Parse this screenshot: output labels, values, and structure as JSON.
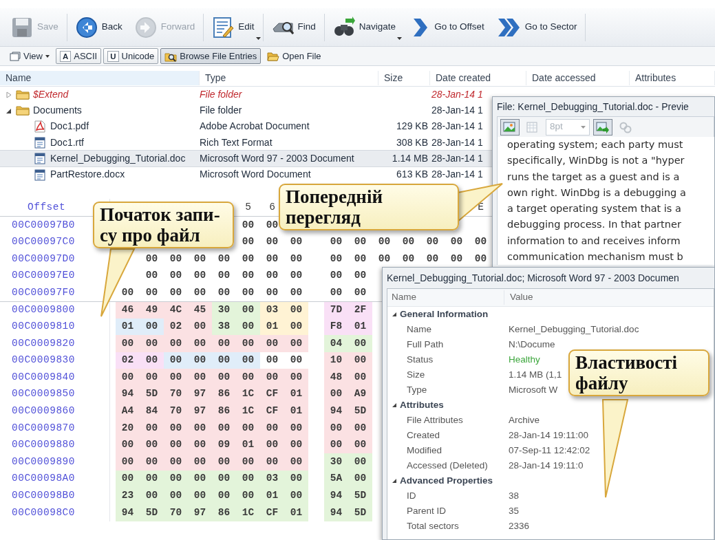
{
  "toolbar": [
    {
      "label": "Save",
      "disabled": true,
      "dropdown": false
    },
    {
      "label": "Back",
      "disabled": false,
      "dropdown": false
    },
    {
      "label": "Forward",
      "disabled": true,
      "dropdown": false
    },
    {
      "label": "Edit",
      "disabled": false,
      "dropdown": true
    },
    {
      "label": "Find",
      "disabled": false,
      "dropdown": false
    },
    {
      "label": "Navigate",
      "disabled": false,
      "dropdown": true
    },
    {
      "label": "Go to Offset",
      "disabled": false,
      "dropdown": false
    },
    {
      "label": "Go to Sector",
      "disabled": false,
      "dropdown": false
    }
  ],
  "view_bar": {
    "view": {
      "label": "View"
    },
    "toggles": [
      {
        "glyph": "A",
        "label": "ASCII",
        "pressed": false
      },
      {
        "glyph": "U",
        "label": "Unicode",
        "pressed": false
      },
      {
        "label": "Browse File Entries",
        "pressed": true
      }
    ],
    "open_file": {
      "label": "Open File"
    }
  },
  "file_list": {
    "columns": [
      "Name",
      "Type",
      "Size",
      "Date created",
      "Date accessed",
      "Attributes"
    ],
    "rows": [
      {
        "kind": "folder",
        "name": "$Extend",
        "type": "File folder",
        "date_created": "28-Jan-14 1",
        "deleted": true,
        "expanded": false,
        "selected": false,
        "children": []
      },
      {
        "kind": "folder",
        "name": "Documents",
        "type": "File folder",
        "date_created": "28-Jan-14 1",
        "deleted": false,
        "expanded": true,
        "selected": false,
        "children": [
          {
            "kind": "pdf",
            "name": "Doc1.pdf",
            "type": "Adobe Acrobat Document",
            "size": "129 KB",
            "date_created": "28-Jan-14 1",
            "deleted": false,
            "selected": false
          },
          {
            "kind": "doc",
            "name": "Doc1.rtf",
            "type": "Rich Text Format",
            "size": "308 KB",
            "date_created": "28-Jan-14 1",
            "deleted": false,
            "selected": false
          },
          {
            "kind": "doc",
            "name": "Kernel_Debugging_Tutorial.doc",
            "type": "Microsoft Word 97 - 2003 Document",
            "size": "1.14 MB",
            "date_created": "28-Jan-14 1",
            "deleted": false,
            "selected": true
          },
          {
            "kind": "doc",
            "name": "PartRestore.docx",
            "type": "Microsoft Word Document",
            "size": "613 KB",
            "date_created": "28-Jan-14 1",
            "deleted": false,
            "selected": false
          }
        ]
      }
    ]
  },
  "hex_view": {
    "offset_label": "Offset",
    "columns": [
      null,
      null,
      null,
      null,
      null,
      "5",
      "6",
      null,
      null,
      null,
      null,
      null,
      null,
      null,
      "E"
    ],
    "rows": [
      {
        "offset": "00C00097B0",
        "sector_start": false,
        "cells": [
          null,
          null,
          null,
          null,
          null,
          {
            "text": "00"
          },
          {
            "text": "00"
          }
        ]
      },
      {
        "offset": "00C00097C0",
        "sector_start": false,
        "cells": [
          null,
          null,
          null,
          null,
          null,
          {
            "text": "00"
          },
          {
            "text": "00"
          },
          {
            "text": "00"
          },
          {
            "text": "00"
          },
          {
            "text": "00"
          },
          {
            "text": "00"
          },
          {
            "text": "00"
          },
          {
            "text": "00"
          },
          {
            "text": "00"
          },
          {
            "text": "00"
          }
        ]
      },
      {
        "offset": "00C00097D0",
        "sector_start": false,
        "cells": [
          null,
          {
            "text": "00"
          },
          {
            "text": "00"
          },
          {
            "text": "00"
          },
          {
            "text": "00"
          },
          {
            "text": "00"
          },
          {
            "text": "00"
          },
          {
            "text": "00"
          },
          {
            "text": "00"
          },
          {
            "text": "00"
          },
          {
            "text": "00"
          },
          {
            "text": "00"
          },
          {
            "text": "00"
          },
          {
            "text": "00"
          },
          {
            "text": "00"
          }
        ]
      },
      {
        "offset": "00C00097E0",
        "sector_start": false,
        "cells": [
          null,
          {
            "text": "00"
          },
          {
            "text": "00"
          },
          {
            "text": "00"
          },
          {
            "text": "00"
          },
          {
            "text": "00"
          },
          {
            "text": "00"
          },
          {
            "text": "00"
          },
          {
            "text": "00"
          },
          {
            "text": "00"
          }
        ]
      },
      {
        "offset": "00C00097F0",
        "sector_start": false,
        "cells": [
          {
            "text": "00"
          },
          {
            "text": "00"
          },
          {
            "text": "00"
          },
          {
            "text": "00"
          },
          {
            "text": "00"
          },
          {
            "text": "00"
          },
          {
            "text": "00"
          },
          {
            "text": "00"
          },
          {
            "text": "00"
          },
          {
            "text": "00"
          }
        ]
      },
      {
        "offset": "00C0009800",
        "sector_start": true,
        "cells": [
          {
            "text": "46",
            "color": "#fbe1e3"
          },
          {
            "text": "49",
            "color": "#fbe1e3"
          },
          {
            "text": "4C",
            "color": "#fbe1e3"
          },
          {
            "text": "45",
            "color": "#fbe1e3"
          },
          {
            "text": "30",
            "color": "#e3f4da"
          },
          {
            "text": "00",
            "color": "#e3f4da"
          },
          {
            "text": "03",
            "color": "#fff3d4"
          },
          {
            "text": "00",
            "color": "#fff3d4"
          },
          {
            "text": "7D",
            "color": "#f9e0f6"
          },
          {
            "text": "2F",
            "color": "#f9e0f6"
          }
        ]
      },
      {
        "offset": "00C0009810",
        "sector_start": false,
        "cells": [
          {
            "text": "01",
            "color": "#e0edf9"
          },
          {
            "text": "00",
            "color": "#e0edf9"
          },
          {
            "text": "02",
            "color": "#fbe1e3"
          },
          {
            "text": "00",
            "color": "#fbe1e3"
          },
          {
            "text": "38",
            "color": "#e3f4da"
          },
          {
            "text": "00",
            "color": "#e3f4da"
          },
          {
            "text": "01",
            "color": "#fff3d4"
          },
          {
            "text": "00",
            "color": "#fff3d4"
          },
          {
            "text": "F8",
            "color": "#f9e0f6"
          },
          {
            "text": "01",
            "color": "#f9e0f6"
          }
        ]
      },
      {
        "offset": "00C0009820",
        "sector_start": false,
        "cells": [
          {
            "text": "00",
            "color": "#fbe1e3"
          },
          {
            "text": "00",
            "color": "#fbe1e3"
          },
          {
            "text": "00",
            "color": "#fbe1e3"
          },
          {
            "text": "00",
            "color": "#fbe1e3"
          },
          {
            "text": "00",
            "color": "#fbe1e3"
          },
          {
            "text": "00",
            "color": "#fbe1e3"
          },
          {
            "text": "00",
            "color": "#fbe1e3"
          },
          {
            "text": "00",
            "color": "#fbe1e3"
          },
          {
            "text": "04",
            "color": "#e3f4da"
          },
          {
            "text": "00",
            "color": "#e3f4da"
          }
        ]
      },
      {
        "offset": "00C0009830",
        "sector_start": false,
        "cells": [
          {
            "text": "02",
            "color": "#f9e0f6"
          },
          {
            "text": "00",
            "color": "#f9e0f6"
          },
          {
            "text": "00",
            "color": "#e0edf9"
          },
          {
            "text": "00",
            "color": "#e0edf9"
          },
          {
            "text": "00",
            "color": "#e0edf9"
          },
          {
            "text": "00",
            "color": "#e0edf9"
          },
          {
            "text": "00"
          },
          {
            "text": "00"
          },
          {
            "text": "10",
            "color": "#fbe1e3"
          },
          {
            "text": "00",
            "color": "#fbe1e3"
          }
        ]
      },
      {
        "offset": "00C0009840",
        "sector_start": false,
        "cells": [
          {
            "text": "00",
            "color": "#fbe1e3"
          },
          {
            "text": "00",
            "color": "#fbe1e3"
          },
          {
            "text": "00",
            "color": "#fbe1e3"
          },
          {
            "text": "00",
            "color": "#fbe1e3"
          },
          {
            "text": "00",
            "color": "#fbe1e3"
          },
          {
            "text": "00",
            "color": "#fbe1e3"
          },
          {
            "text": "00",
            "color": "#fbe1e3"
          },
          {
            "text": "00",
            "color": "#fbe1e3"
          },
          {
            "text": "48",
            "color": "#fbe1e3"
          },
          {
            "text": "00",
            "color": "#fbe1e3"
          }
        ]
      },
      {
        "offset": "00C0009850",
        "sector_start": false,
        "cells": [
          {
            "text": "94",
            "color": "#fbe1e3"
          },
          {
            "text": "5D",
            "color": "#fbe1e3"
          },
          {
            "text": "70",
            "color": "#fbe1e3"
          },
          {
            "text": "97",
            "color": "#fbe1e3"
          },
          {
            "text": "86",
            "color": "#fbe1e3"
          },
          {
            "text": "1C",
            "color": "#fbe1e3"
          },
          {
            "text": "CF",
            "color": "#fbe1e3"
          },
          {
            "text": "01",
            "color": "#fbe1e3"
          },
          {
            "text": "00",
            "color": "#fbe1e3"
          },
          {
            "text": "A9",
            "color": "#fbe1e3"
          }
        ]
      },
      {
        "offset": "00C0009860",
        "sector_start": false,
        "cells": [
          {
            "text": "A4",
            "color": "#fbe1e3"
          },
          {
            "text": "84",
            "color": "#fbe1e3"
          },
          {
            "text": "70",
            "color": "#fbe1e3"
          },
          {
            "text": "97",
            "color": "#fbe1e3"
          },
          {
            "text": "86",
            "color": "#fbe1e3"
          },
          {
            "text": "1C",
            "color": "#fbe1e3"
          },
          {
            "text": "CF",
            "color": "#fbe1e3"
          },
          {
            "text": "01",
            "color": "#fbe1e3"
          },
          {
            "text": "94",
            "color": "#fbe1e3"
          },
          {
            "text": "5D",
            "color": "#fbe1e3"
          }
        ]
      },
      {
        "offset": "00C0009870",
        "sector_start": false,
        "cells": [
          {
            "text": "20",
            "color": "#fbe1e3"
          },
          {
            "text": "00",
            "color": "#fbe1e3"
          },
          {
            "text": "00",
            "color": "#fbe1e3"
          },
          {
            "text": "00",
            "color": "#fbe1e3"
          },
          {
            "text": "00",
            "color": "#fbe1e3"
          },
          {
            "text": "00",
            "color": "#fbe1e3"
          },
          {
            "text": "00",
            "color": "#fbe1e3"
          },
          {
            "text": "00",
            "color": "#fbe1e3"
          },
          {
            "text": "00",
            "color": "#fbe1e3"
          },
          {
            "text": "00",
            "color": "#fbe1e3"
          }
        ]
      },
      {
        "offset": "00C0009880",
        "sector_start": false,
        "cells": [
          {
            "text": "00",
            "color": "#fbe1e3"
          },
          {
            "text": "00",
            "color": "#fbe1e3"
          },
          {
            "text": "00",
            "color": "#fbe1e3"
          },
          {
            "text": "00",
            "color": "#fbe1e3"
          },
          {
            "text": "09",
            "color": "#fbe1e3"
          },
          {
            "text": "01",
            "color": "#fbe1e3"
          },
          {
            "text": "00",
            "color": "#fbe1e3"
          },
          {
            "text": "00",
            "color": "#fbe1e3"
          },
          {
            "text": "00",
            "color": "#fbe1e3"
          },
          {
            "text": "00",
            "color": "#fbe1e3"
          }
        ]
      },
      {
        "offset": "00C0009890",
        "sector_start": false,
        "cells": [
          {
            "text": "00",
            "color": "#fbe1e3"
          },
          {
            "text": "00",
            "color": "#fbe1e3"
          },
          {
            "text": "00",
            "color": "#fbe1e3"
          },
          {
            "text": "00",
            "color": "#fbe1e3"
          },
          {
            "text": "00",
            "color": "#fbe1e3"
          },
          {
            "text": "00",
            "color": "#fbe1e3"
          },
          {
            "text": "00",
            "color": "#fbe1e3"
          },
          {
            "text": "00",
            "color": "#fbe1e3"
          },
          {
            "text": "30",
            "color": "#e3f4da"
          },
          {
            "text": "00",
            "color": "#e3f4da"
          }
        ]
      },
      {
        "offset": "00C00098A0",
        "sector_start": false,
        "cells": [
          {
            "text": "00",
            "color": "#e3f4da"
          },
          {
            "text": "00",
            "color": "#e3f4da"
          },
          {
            "text": "00",
            "color": "#e3f4da"
          },
          {
            "text": "00",
            "color": "#e3f4da"
          },
          {
            "text": "00",
            "color": "#e3f4da"
          },
          {
            "text": "00",
            "color": "#e3f4da"
          },
          {
            "text": "03",
            "color": "#e3f4da"
          },
          {
            "text": "00",
            "color": "#e3f4da"
          },
          {
            "text": "5A",
            "color": "#e3f4da"
          },
          {
            "text": "00",
            "color": "#e3f4da"
          }
        ]
      },
      {
        "offset": "00C00098B0",
        "sector_start": false,
        "cells": [
          {
            "text": "23",
            "color": "#e3f4da"
          },
          {
            "text": "00",
            "color": "#e3f4da"
          },
          {
            "text": "00",
            "color": "#e3f4da"
          },
          {
            "text": "00",
            "color": "#e3f4da"
          },
          {
            "text": "00",
            "color": "#e3f4da"
          },
          {
            "text": "00",
            "color": "#e3f4da"
          },
          {
            "text": "01",
            "color": "#e3f4da"
          },
          {
            "text": "00",
            "color": "#e3f4da"
          },
          {
            "text": "94",
            "color": "#e3f4da"
          },
          {
            "text": "5D",
            "color": "#e3f4da"
          }
        ]
      },
      {
        "offset": "00C00098C0",
        "sector_start": false,
        "cells": [
          {
            "text": "94",
            "color": "#e3f4da"
          },
          {
            "text": "5D",
            "color": "#e3f4da"
          },
          {
            "text": "70",
            "color": "#e3f4da"
          },
          {
            "text": "97",
            "color": "#e3f4da"
          },
          {
            "text": "86",
            "color": "#e3f4da"
          },
          {
            "text": "1C",
            "color": "#e3f4da"
          },
          {
            "text": "CF",
            "color": "#e3f4da"
          },
          {
            "text": "01",
            "color": "#e3f4da"
          },
          {
            "text": "94",
            "color": "#e3f4da"
          },
          {
            "text": "5D",
            "color": "#e3f4da"
          }
        ]
      }
    ]
  },
  "preview": {
    "title": "File: Kernel_Debugging_Tutorial.doc - Previe",
    "buttons": [
      {
        "pressed": true,
        "disabled": false
      },
      {
        "pressed": false,
        "disabled": true
      },
      {
        "pressed": true,
        "disabled": false
      },
      {
        "pressed": false,
        "disabled": true
      }
    ],
    "font_size": {
      "value": "8pt",
      "disabled": true
    },
    "lines": [
      "operating system; each party must",
      "specifically, WinDbg is not a \"hyper",
      "runs the target as a guest and is a",
      "own right. WinDbg is a debugging a",
      "a target operating system that is a",
      "debugging process. In that partner",
      "information to and receives inform",
      "communication mechanism must b"
    ]
  },
  "properties": {
    "title": "Kernel_Debugging_Tutorial.doc; Microsoft Word 97 - 2003 Documen",
    "columns": [
      "Name",
      "Value"
    ],
    "groups": [
      {
        "label": "General Information",
        "expanded": true,
        "items": [
          {
            "name": "Name",
            "value": "Kernel_Debugging_Tutorial.doc"
          },
          {
            "name": "Full Path",
            "value": "N:\\Docume"
          },
          {
            "name": "Status",
            "value": "Healthy",
            "color": "#3ca63c"
          },
          {
            "name": "Size",
            "value": "1.14 MB (1,1"
          },
          {
            "name": "Type",
            "value": "Microsoft W"
          }
        ]
      },
      {
        "label": "Attributes",
        "expanded": true,
        "items": [
          {
            "name": "File Attributes",
            "value": "Archive"
          },
          {
            "name": "Created",
            "value": "28-Jan-14 19:11:00"
          },
          {
            "name": "Modified",
            "value": "07-Sep-11 12:42:02"
          },
          {
            "name": "Accessed (Deleted)",
            "value": "28-Jan-14 19:11:0"
          }
        ]
      },
      {
        "label": "Advanced Properties",
        "expanded": true,
        "items": [
          {
            "name": "ID",
            "value": "38"
          },
          {
            "name": "Parent ID",
            "value": "35"
          },
          {
            "name": "Total sectors",
            "value": "2336"
          }
        ]
      }
    ]
  },
  "callouts": [
    {
      "lines": [
        "Початок запи-",
        "су про файл"
      ]
    },
    {
      "lines": [
        "Попередній",
        "перегляд"
      ]
    },
    {
      "lines": [
        "Властивості",
        "файлу"
      ]
    }
  ]
}
